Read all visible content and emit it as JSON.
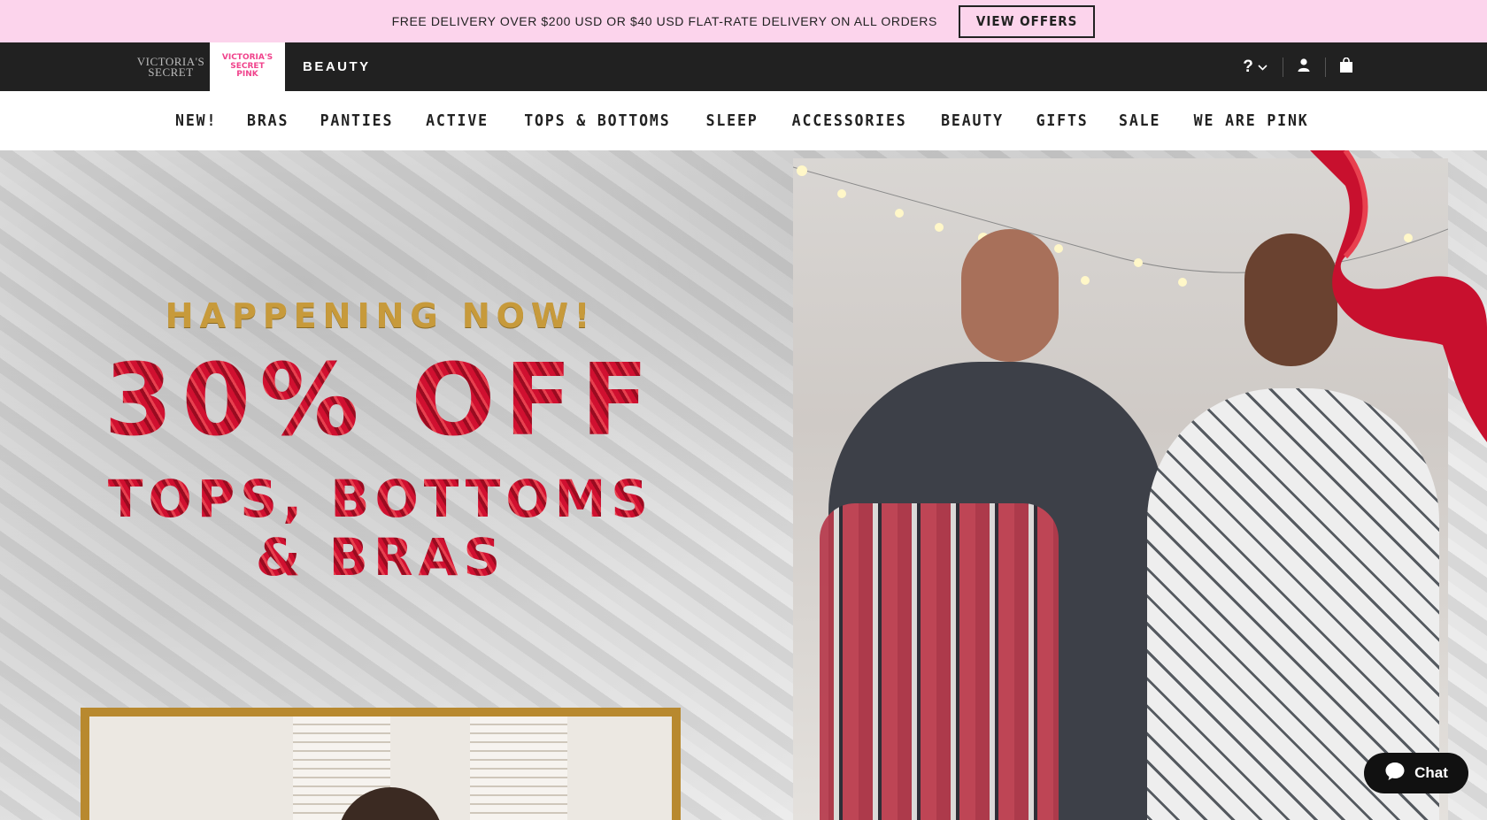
{
  "promo": {
    "text": "FREE DELIVERY OVER $200 USD OR $40 USD FLAT-RATE DELIVERY ON ALL ORDERS",
    "button": "VIEW OFFERS"
  },
  "brands": {
    "vs_line1": "VICTORIA'S",
    "vs_line2": "SECRET",
    "pink_line1": "VICTORIA'S",
    "pink_line2": "SECRET",
    "pink_line3": "PINK",
    "beauty": "BEAUTY"
  },
  "utility": {
    "help_label": "?",
    "help_icon": "chevron-down-icon",
    "account_icon": "user-icon",
    "bag_icon": "shopping-bag-icon"
  },
  "nav": {
    "items": [
      "NEW!",
      "BRAS",
      "PANTIES",
      "ACTIVE",
      "TOPS & BOTTOMS",
      "SLEEP",
      "ACCESSORIES",
      "BEAUTY",
      "GIFTS",
      "SALE",
      "WE ARE PINK"
    ]
  },
  "hero": {
    "kicker": "HAPPENING NOW!",
    "headline": "30% OFF",
    "sub1": "TOPS, BOTTOMS",
    "sub2": "& BRAS"
  },
  "chat": {
    "label": "Chat",
    "icon": "chat-bubble-icon"
  },
  "colors": {
    "promo_bg": "#fcd4ec",
    "brandbar_bg": "#212121",
    "pink_brand": "#f0438c",
    "gold": "#c79a3b",
    "glitter_red": "#c0102a"
  }
}
